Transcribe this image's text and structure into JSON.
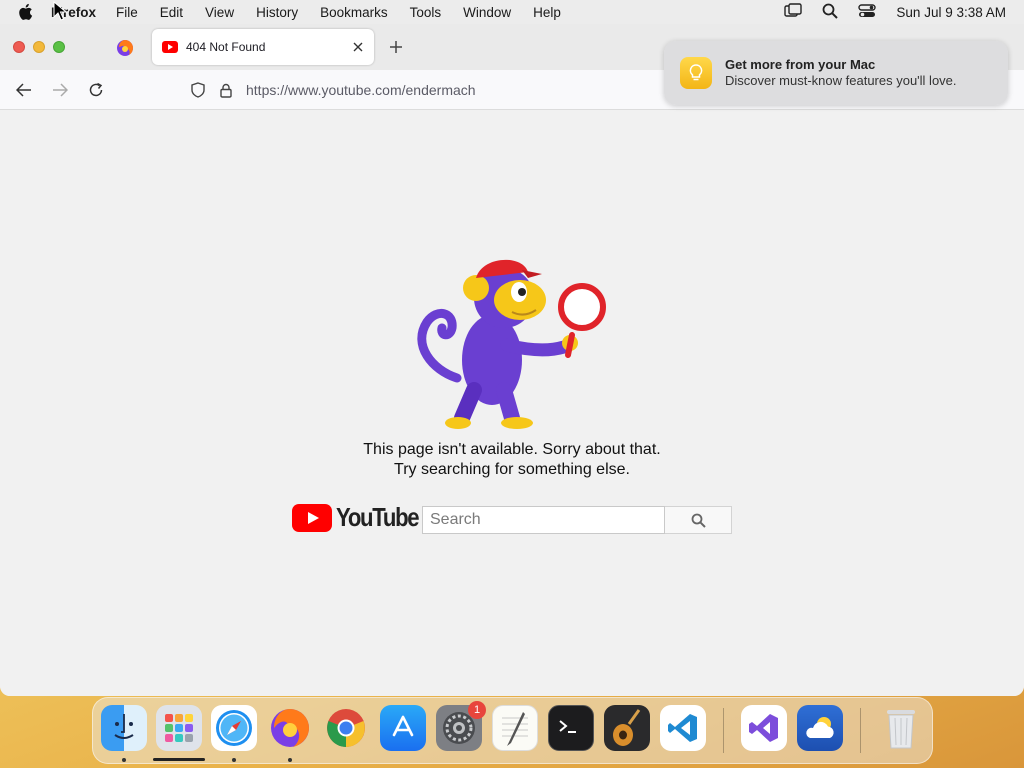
{
  "menubar": {
    "app_name": "Firefox",
    "menus": [
      "File",
      "Edit",
      "View",
      "History",
      "Bookmarks",
      "Tools",
      "Window",
      "Help"
    ],
    "clock": "Sun Jul 9  3:38 AM"
  },
  "browser": {
    "tab_title": "404 Not Found",
    "url": "https://www.youtube.com/endermach"
  },
  "page": {
    "message_line1": "This page isn't available. Sorry about that.",
    "message_line2": "Try searching for something else.",
    "logo_text": "YouTube",
    "search_placeholder": "Search"
  },
  "notification": {
    "title": "Get more from your Mac",
    "body": "Discover must-know features you'll love."
  },
  "dock": {
    "settings_badge": "1",
    "apps": [
      "Finder",
      "Launchpad",
      "Safari",
      "Firefox",
      "Chrome",
      "App Store",
      "System Settings",
      "TextEdit",
      "Terminal",
      "GarageBand",
      "Visual Studio Code",
      "Visual Studio",
      "Weather",
      "Trash"
    ]
  },
  "colors": {
    "youtube_red": "#ff0000",
    "monkey_purple": "#6a3fd1",
    "monkey_yellow": "#f6c719"
  }
}
